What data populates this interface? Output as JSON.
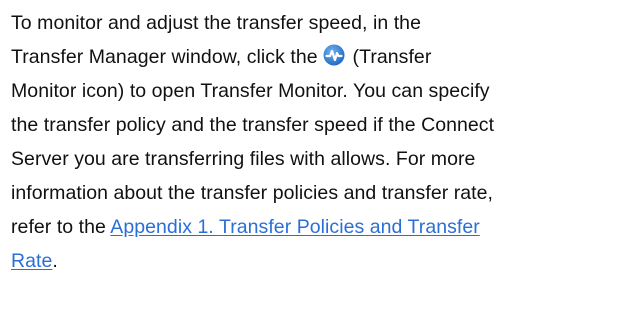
{
  "content": {
    "line1": "To monitor and adjust the transfer speed, in the",
    "line2_before_icon": "Transfer Manager window, click the ",
    "line2_after_icon": " (Transfer",
    "line3": "Monitor icon) to open Transfer Monitor. You can specify",
    "line4": "the transfer policy and the transfer speed if the Connect",
    "line5": "Server you are transferring files with allows. For more",
    "line6": "information about the transfer policies and transfer rate,",
    "line7_before_link": "refer to the ",
    "link_part1": "Appendix 1. Transfer Policies and Transfer",
    "link_part2": "Rate",
    "line8_after_link": "."
  },
  "icon": {
    "name": "transfer-monitor-icon",
    "color": "#2f7fd3"
  },
  "colors": {
    "text": "#111111",
    "link": "#2a6fd6",
    "background": "#ffffff"
  }
}
